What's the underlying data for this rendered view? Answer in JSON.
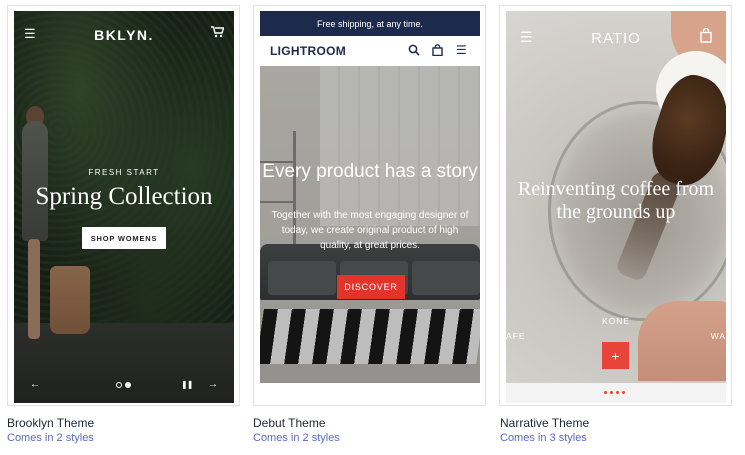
{
  "themes": [
    {
      "name": "Brooklyn Theme",
      "styles": "Comes in 2 styles",
      "preview": {
        "logo": "BKLYN.",
        "eyebrow": "FRESH START",
        "headline": "Spring Collection",
        "button": "SHOP WOMENS",
        "menu_icon": "menu-icon",
        "cart_icon": "cart-icon",
        "prev_icon": "arrow-left-icon",
        "next_icon": "arrow-right-icon",
        "pause_icon": "pause-icon",
        "slide_count": 2,
        "active_slide": 2
      }
    },
    {
      "name": "Debut Theme",
      "styles": "Comes in 2 styles",
      "preview": {
        "banner": "Free shipping, at any time.",
        "logo": "LIGHTROOM",
        "headline": "Every product has a story",
        "subtext": "Together with the most engaging designer of today, we create original product of high quality, at great prices.",
        "button": "DISCOVER",
        "search_icon": "search-icon",
        "bag_icon": "bag-icon",
        "menu_icon": "menu-icon"
      }
    },
    {
      "name": "Narrative Theme",
      "styles": "Comes in 3 styles",
      "preview": {
        "logo": "RATIO",
        "headline": "Reinventing coffee from the grounds up",
        "product_label": "KONE",
        "left_label": "AFE",
        "right_label": "WA",
        "plus_button": "+",
        "menu_icon": "menu-icon",
        "bag_icon": "bag-icon",
        "slide_count": 4
      }
    }
  ],
  "colors": {
    "debut_banner": "#1e2a4c",
    "debut_button": "#e2342b",
    "narrative_accent": "#e7443a",
    "caption_link": "#5c6ac4",
    "caption_title": "#212b36"
  }
}
